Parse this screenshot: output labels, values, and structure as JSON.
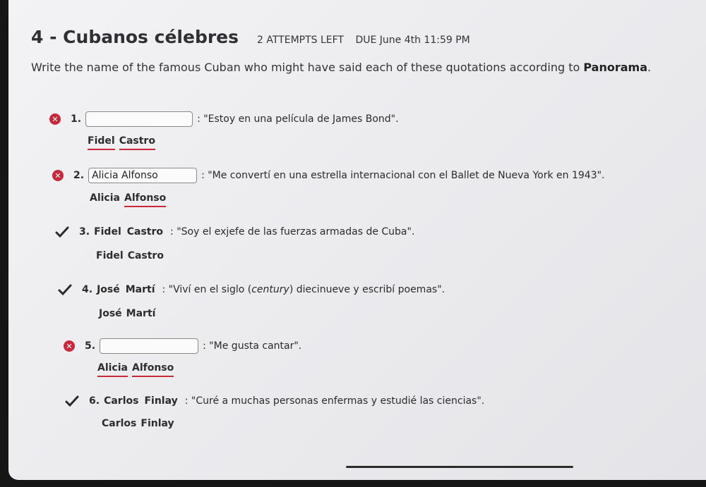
{
  "header": {
    "title": "4 - Cubanos célebres",
    "attempts": "2 ATTEMPTS LEFT",
    "due": "DUE  June 4th 11:59 PM"
  },
  "instructions": {
    "text_before": "Write the name of the famous Cuban who might have said each of these quotations according to ",
    "bold": "Panorama",
    "text_after": "."
  },
  "questions": [
    {
      "num": "1.",
      "status": "incorrect",
      "input_value": "",
      "quote": ": \"Estoy en una película de James Bond\".",
      "answer_first": "Fidel",
      "answer_last": "Castro"
    },
    {
      "num": "2.",
      "status": "incorrect",
      "input_value": "Alicia Alfonso",
      "quote": ": \"Me convertí en una estrella internacional con el Ballet de Nueva York en 1943\".",
      "answer_first": "Alicia",
      "answer_last": "Alfonso"
    },
    {
      "num": "3.",
      "status": "correct",
      "filled_first": "Fidel",
      "filled_last": "Castro",
      "quote": ": \"Soy el exjefe de las fuerzas armadas de Cuba\".",
      "answer_first": "Fidel",
      "answer_last": "Castro"
    },
    {
      "num": "4.",
      "status": "correct",
      "filled_first": "José",
      "filled_last": "Martí",
      "quote_a": ": \"Viví en el siglo (",
      "quote_italic": "century",
      "quote_b": ") diecinueve y escribí poemas\".",
      "answer_first": "José",
      "answer_last": "Martí"
    },
    {
      "num": "5.",
      "status": "incorrect",
      "input_value": "",
      "quote": ": \"Me gusta cantar\".",
      "answer_first": "Alicia",
      "answer_last": "Alfonso"
    },
    {
      "num": "6.",
      "status": "correct",
      "filled_first": "Carlos",
      "filled_last": "Finlay",
      "quote": ": \"Curé a muchas personas enfermas y estudié las ciencias\".",
      "answer_first": "Carlos",
      "answer_last": "Finlay"
    }
  ],
  "colors": {
    "incorrect": "#c8283a",
    "correct": "#2a2a2a"
  }
}
